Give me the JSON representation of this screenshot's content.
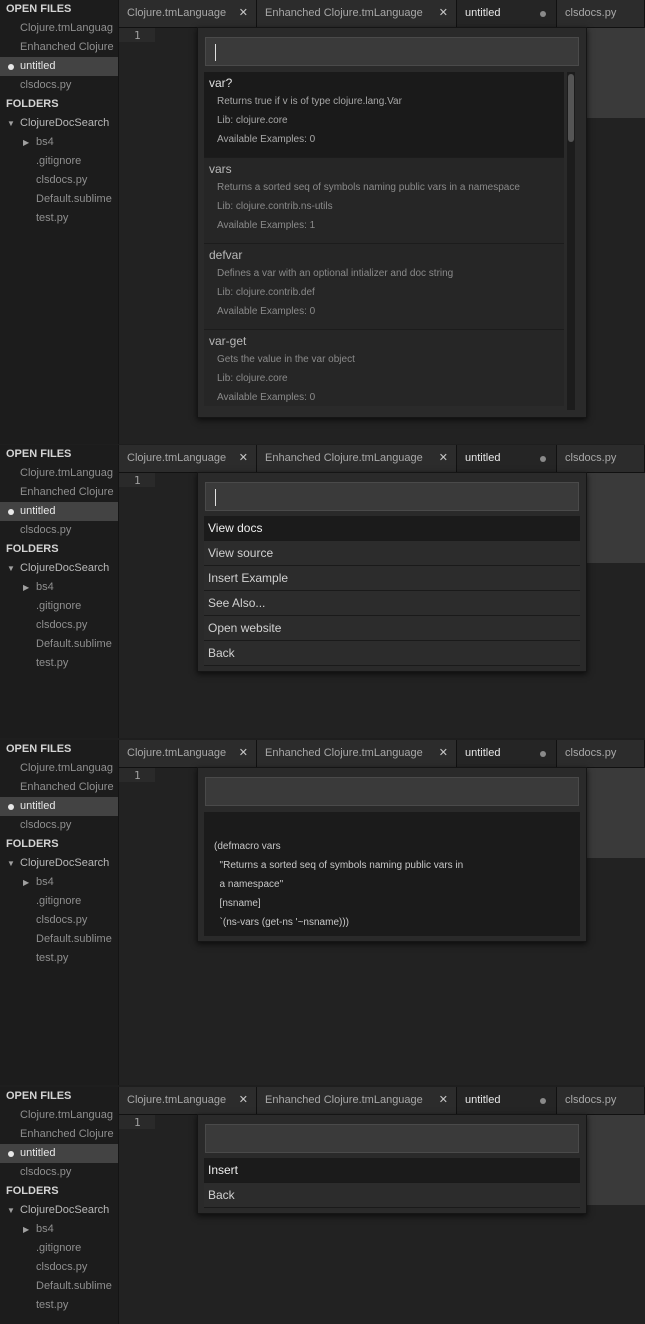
{
  "sidebar": {
    "open_files_header": "OPEN FILES",
    "open_files": [
      "Clojure.tmLanguag",
      "Enhanched Clojure",
      "untitled",
      "clsdocs.py"
    ],
    "folders_header": "FOLDERS",
    "root_folder": "ClojureDocSearch",
    "children": [
      "bs4",
      ".gitignore",
      "clsdocs.py",
      "Default.sublime",
      "test.py"
    ]
  },
  "tabs": [
    "Clojure.tmLanguage",
    "Enhanched Clojure.tmLanguage",
    "untitled",
    "clsdocs.py"
  ],
  "editor": {
    "line_number": "1"
  },
  "panel1": {
    "results": [
      {
        "title": "var?",
        "desc": "Returns true if v is of type clojure.lang.Var",
        "lib": "Lib: clojure.core",
        "examples": "Available Examples: 0"
      },
      {
        "title": "vars",
        "desc": "Returns a sorted seq of symbols naming public vars in a namespace",
        "lib": "Lib: clojure.contrib.ns-utils",
        "examples": "Available Examples: 1"
      },
      {
        "title": "defvar",
        "desc": "Defines a var with an optional intializer and doc string",
        "lib": "Lib: clojure.contrib.def",
        "examples": "Available Examples: 0"
      },
      {
        "title": "var-get",
        "desc": "Gets the value in the var object",
        "lib": "Lib: clojure.core",
        "examples": "Available Examples: 0"
      }
    ]
  },
  "panel2": {
    "menu": [
      "View docs",
      "View source",
      "Insert Example",
      "See Also...",
      "Open website",
      "Back"
    ]
  },
  "panel3": {
    "code": [
      "(defmacro vars",
      "  \"Returns a sorted seq of symbols naming public vars in",
      "  a namespace\"",
      "  [nsname]",
      "  `(ns-vars (get-ns '~nsname)))"
    ]
  },
  "panel4": {
    "menu": [
      "Insert",
      "Back"
    ]
  }
}
